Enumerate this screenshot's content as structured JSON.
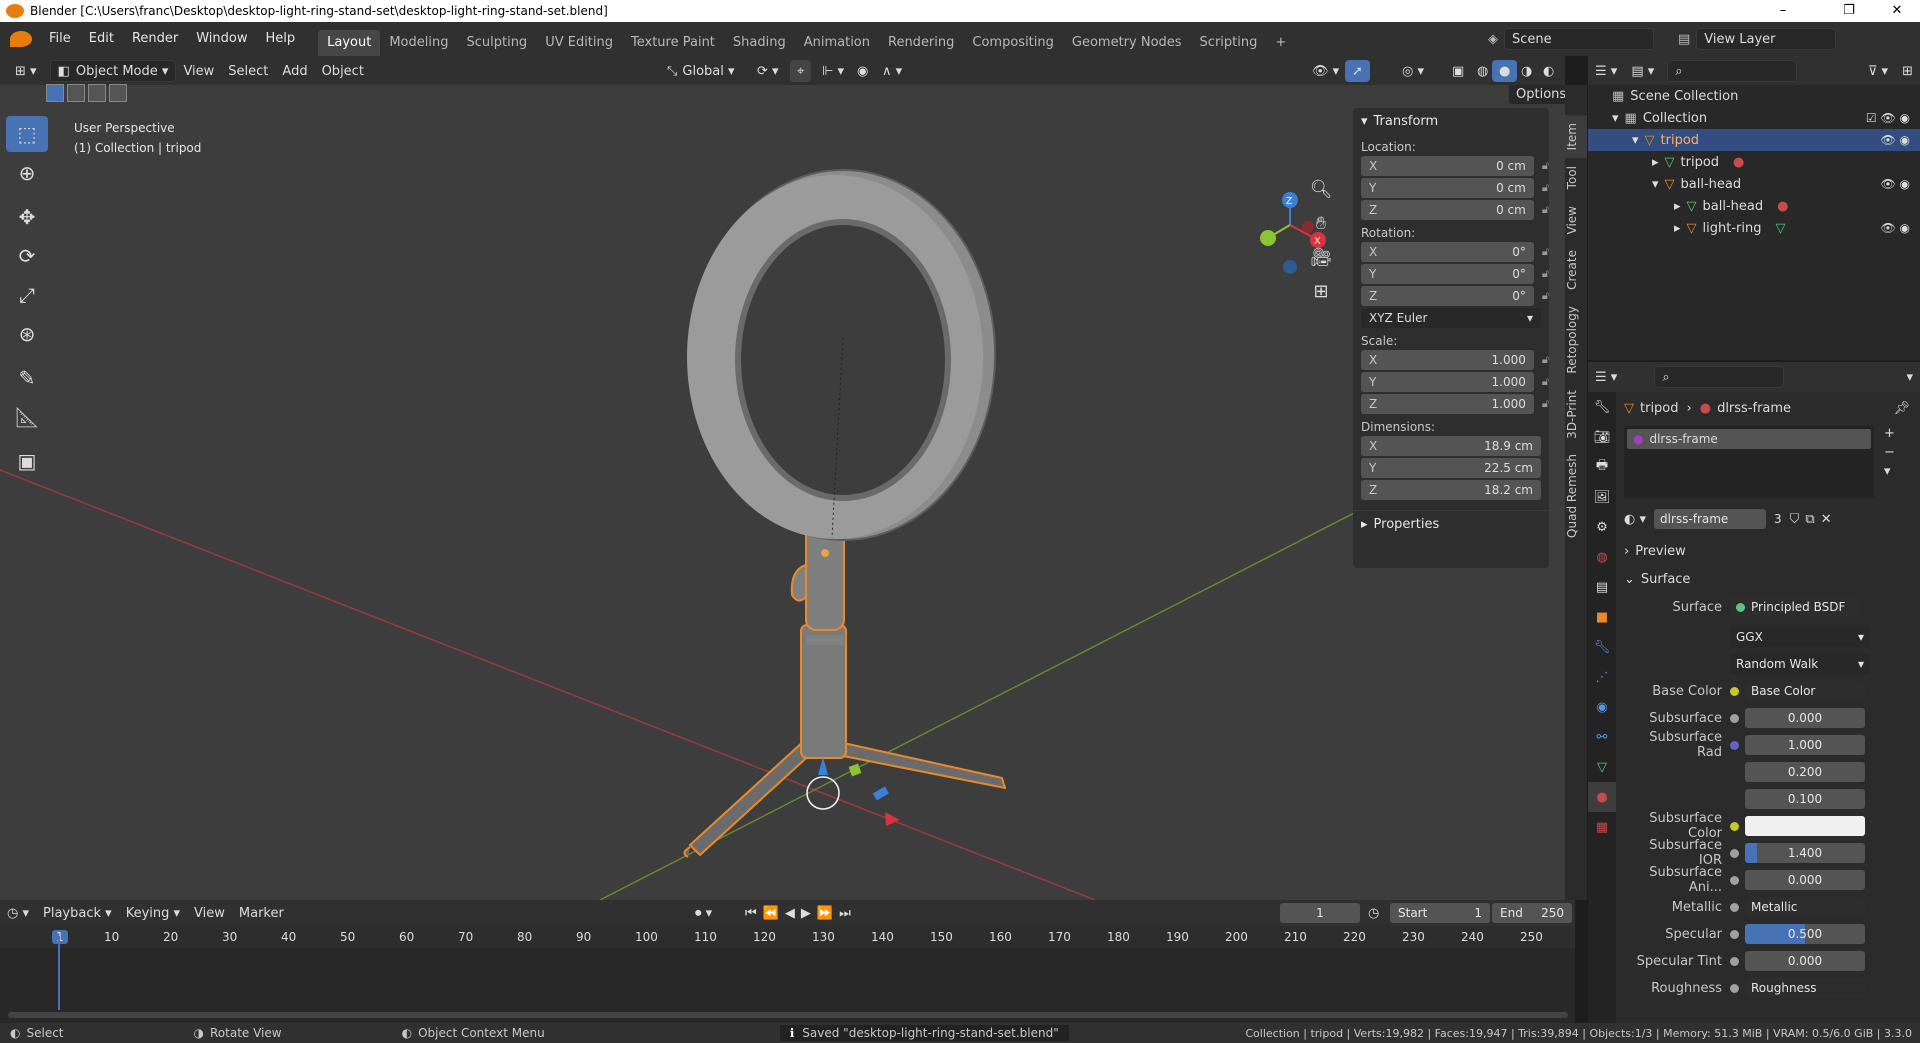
{
  "titlebar": {
    "title": "Blender [C:\\Users\\franc\\Desktop\\desktop-light-ring-stand-set\\desktop-light-ring-stand-set.blend]",
    "minimize": "–",
    "maximize": "❐",
    "close": "✕"
  },
  "menu": [
    "File",
    "Edit",
    "Render",
    "Window",
    "Help"
  ],
  "workspaces": [
    "Layout",
    "Modeling",
    "Sculpting",
    "UV Editing",
    "Texture Paint",
    "Shading",
    "Animation",
    "Rendering",
    "Compositing",
    "Geometry Nodes",
    "Scripting",
    "+"
  ],
  "scene": {
    "scene_label": "Scene",
    "view_layer_label": "View Layer"
  },
  "viewport_header": {
    "mode": "Object Mode",
    "view": "View",
    "select": "Select",
    "add": "Add",
    "object": "Object",
    "orientation": "Global",
    "options": "Options"
  },
  "viewport": {
    "perspective": "User Perspective",
    "collection_path": "(1) Collection | tripod",
    "gizmo_x": "X",
    "gizmo_y": "Y",
    "gizmo_z": "Z"
  },
  "npanel": {
    "transform_title": "Transform",
    "location_label": "Location:",
    "location": [
      {
        "axis": "X",
        "value": "0 cm"
      },
      {
        "axis": "Y",
        "value": "0 cm"
      },
      {
        "axis": "Z",
        "value": "0 cm"
      }
    ],
    "rotation_label": "Rotation:",
    "rotation": [
      {
        "axis": "X",
        "value": "0°"
      },
      {
        "axis": "Y",
        "value": "0°"
      },
      {
        "axis": "Z",
        "value": "0°"
      }
    ],
    "rotation_mode": "XYZ Euler",
    "scale_label": "Scale:",
    "scale": [
      {
        "axis": "X",
        "value": "1.000"
      },
      {
        "axis": "Y",
        "value": "1.000"
      },
      {
        "axis": "Z",
        "value": "1.000"
      }
    ],
    "dimensions_label": "Dimensions:",
    "dimensions": [
      {
        "axis": "X",
        "value": "18.9 cm"
      },
      {
        "axis": "Y",
        "value": "22.5 cm"
      },
      {
        "axis": "Z",
        "value": "18.2 cm"
      }
    ],
    "properties_title": "Properties"
  },
  "vertical_tabs": [
    "Item",
    "Tool",
    "View",
    "Create",
    "Retopology",
    "3D-Print",
    "Quad Remesh"
  ],
  "outliner": {
    "scene_collection": "Scene Collection",
    "collection": "Collection",
    "items": [
      {
        "label": "tripod",
        "level": 2
      },
      {
        "label": "tripod",
        "level": 3
      },
      {
        "label": "ball-head",
        "level": 3
      },
      {
        "label": "ball-head",
        "level": 4
      },
      {
        "label": "light-ring",
        "level": 4
      }
    ]
  },
  "properties": {
    "breadcrumb_object": "tripod",
    "breadcrumb_material": "dlrss-frame",
    "material_slot": "dlrss-frame",
    "material_name": "dlrss-frame",
    "user_count": "3",
    "preview": "Preview",
    "surface_section": "Surface",
    "surface_label": "Surface",
    "surface_value": "Principled BSDF",
    "distribution": "GGX",
    "subsurface_method": "Random Walk",
    "rows": [
      {
        "label": "Base Color",
        "value": "Base Color",
        "dot": "#c7c729"
      },
      {
        "label": "Subsurface",
        "value": "0.000",
        "dot": "#a0a0a0"
      },
      {
        "label": "Subsurface Rad",
        "value": "1.000",
        "dot": "#6363c7"
      },
      {
        "label": "",
        "value": "0.200",
        "dot": ""
      },
      {
        "label": "",
        "value": "0.100",
        "dot": ""
      },
      {
        "label": "Subsurface Color",
        "value": "",
        "dot": "#c7c729"
      },
      {
        "label": "Subsurface IOR",
        "value": "1.400",
        "dot": "#a0a0a0"
      },
      {
        "label": "Subsurface Ani...",
        "value": "0.000",
        "dot": "#a0a0a0"
      },
      {
        "label": "Metallic",
        "value": "Metallic",
        "dot": "#a0a0a0"
      },
      {
        "label": "Specular",
        "value": "0.500",
        "dot": "#a0a0a0"
      },
      {
        "label": "Specular Tint",
        "value": "0.000",
        "dot": "#a0a0a0"
      },
      {
        "label": "Roughness",
        "value": "Roughness",
        "dot": "#a0a0a0"
      }
    ]
  },
  "timeline": {
    "playback": "Playback",
    "keying": "Keying",
    "view": "View",
    "marker": "Marker",
    "current_frame": "1",
    "start_label": "Start",
    "start": "1",
    "end_label": "End",
    "end": "250",
    "ticks": [
      "1",
      "10",
      "20",
      "30",
      "40",
      "50",
      "60",
      "70",
      "80",
      "90",
      "100",
      "110",
      "120",
      "130",
      "140",
      "150",
      "160",
      "170",
      "180",
      "190",
      "200",
      "210",
      "220",
      "230",
      "240",
      "250"
    ]
  },
  "statusbar": {
    "select": "Select",
    "rotate": "Rotate View",
    "context": "Object Context Menu",
    "saved": "Saved \"desktop-light-ring-stand-set.blend\"",
    "stats": "Collection | tripod | Verts:19,982 | Faces:19,947 | Tris:39,894 | Objects:1/3 | Memory: 51.3 MiB | VRAM: 0.5/6.0 GiB | 3.3.0"
  },
  "colors": {
    "accent": "#4772b3",
    "selection": "#e88a2b",
    "x_axis": "#d8333f",
    "y_axis": "#8ec433",
    "z_axis": "#3a80d6"
  }
}
